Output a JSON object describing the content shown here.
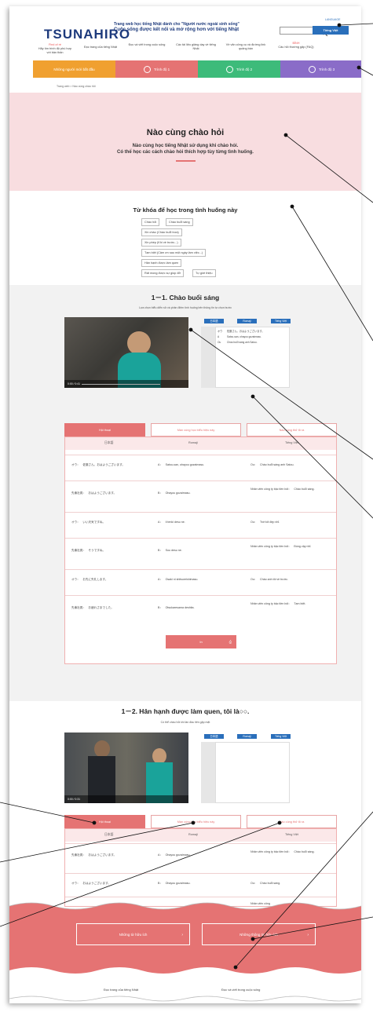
{
  "header": {
    "logo": "TSUNAHIRO",
    "tagline_top": "Trang web học tiếng Nhật dành cho \"Người nước ngoài sinh sống\"",
    "tagline_main": "Cuộc sống được kết nối và mở rộng hơn với tiếng Nhật",
    "language_label": "LANGUAGE",
    "language_button": "Tiếng Việt",
    "nav": [
      {
        "hi": "Find of rè",
        "label": "Hãy tìm trình độ phù hợp với bản thân"
      },
      {
        "hi": "",
        "label": "Đọc trang của tiếng Nhật"
      },
      {
        "hi": "",
        "label": "Đọc và viết trong cuộc sống"
      },
      {
        "hi": "",
        "label": "Các tài liệu giảng dạy về tiếng Nhật"
      },
      {
        "hi": "",
        "label": "Về văn công cụ và đường link quảng bán"
      },
      {
        "hi": "BÌNH",
        "label": "Câu hỏi thường gặp (FAQ)"
      }
    ]
  },
  "levels": [
    {
      "label": "Những người mới bắt đầu",
      "color": "#f0a030"
    },
    {
      "label": "Trình độ 1",
      "color": "#e57373"
    },
    {
      "label": "Trình độ 2",
      "color": "#3dbb7a"
    },
    {
      "label": "Trình độ 3",
      "color": "#8a6cc8"
    }
  ],
  "breadcrumb": "Trang web  >  Nào cùng chào hỏi",
  "hero": {
    "title": "Nào cùng chào hỏi",
    "sub1": "Nào cùng học tiếng Nhật sử dụng khi chào hỏi.",
    "sub2": "Có thể học các cách chào hỏi thích hợp tùy từng tình huống."
  },
  "keywords": {
    "title": "Từ khóa để học trong tình huống này",
    "chips": [
      "Chào hỏi",
      "Chào buổi sáng",
      "Xin chào (Chào buổi trưa)",
      "Xin phép (Khi về trước...)",
      "Tạm biệt (Cảm ơn sau một ngày làm việc...)",
      "Hân hạnh được làm quen",
      "Rất mong được sự giúp đỡ",
      "Tự giới thiệu"
    ]
  },
  "section1": {
    "title": "1－1.  Chào buổi sáng",
    "desc": "Lựa chọn biểu diễn sử và phản điệm tình huống bên thông tin tự chọn bước",
    "subs": [
      "日本語",
      "Romaji",
      "Tiếng Việt"
    ],
    "panel": [
      {
        "spk": "オウ",
        "text": "佐藤さん、おはようございます。"
      },
      {
        "spk": "A",
        "text": "Satou-san, ohayou gozaimasu."
      },
      {
        "spk": "Ou",
        "text": "Chào buổi sáng anh Satou."
      }
    ],
    "tabs": [
      "Hội thoại",
      "Màn cùng học biểu hiệu này",
      "Nào cùng thử tỏ ra"
    ],
    "headers": [
      "日本語",
      "Romaji",
      "Tiếng Việt"
    ],
    "rows": [
      [
        "オウ：　佐藤さん、おはようございます。",
        "A：　Satou-san, ohayou gozaimasu.",
        "Ou：　Chào buổi sáng anh Satou."
      ],
      [
        "先輩社員：　おはようございます。",
        "B：　Ohayou gozaimasu.",
        "Nhân viên công ty bậc tiền bối：　Chào buổi sáng."
      ],
      [
        "オウ：　いい天気ですね。",
        "A：　Ii tenki desu ne.",
        "Ou：　Trời tốt đẹp nhỉ."
      ],
      [
        "先輩社員：　そうですね。",
        "B：　Sou desu ne.",
        "Nhân viên công ty bậc tiền bối：　Đúng vậy nhỉ."
      ],
      [
        "オウ：　お先に失礼します。",
        "A：　Osaki ni shitsureishimasu.",
        "Ou：　Chào anh tôi về trước."
      ],
      [
        "先輩社員：　お疲れさまでした。",
        "B：　Otsukaresama deshita.",
        "Nhân viên công ty bậc tiền bối：　Tạm biệt."
      ]
    ],
    "print_button": "In",
    "video_time": "0:00 / 0:41"
  },
  "section2": {
    "title": "1－2.  Hân hạnh được làm quen, tôi là○○.",
    "desc": "Có thể chào hỏi khi lần đầu tiên gặp mặt",
    "subs": [
      "日本語",
      "Romaji",
      "Tiếng Việt"
    ],
    "tabs": [
      "Hội thoại",
      "Màn cùng học biểu hiệu này",
      "Nào cùng thử tỏ ra"
    ],
    "headers": [
      "日本語",
      "Romaji",
      "Tiếng Việt"
    ],
    "rows": [
      [
        "先輩社員：　おはようございます。",
        "A：　Ohayou gozaimasu.",
        "Nhân viên công ty bậc tiền bối：　Chào buổi sáng."
      ],
      [
        "オウ：　おはようございます。",
        "B：　Ohayou gozaimasu.",
        "Ou：　Chào buổi sáng."
      ],
      [
        "",
        "",
        "Nhân viên công"
      ]
    ],
    "video_time": "0:00 / 0:31"
  },
  "bottom": {
    "btn_left": "Những từ hữu ích",
    "btn_right": "Những thông tin hữu ích",
    "footer_left": "Đọc trang của tiếng Nhật",
    "footer_right": "Đọc và viết trong cuộc sống"
  }
}
